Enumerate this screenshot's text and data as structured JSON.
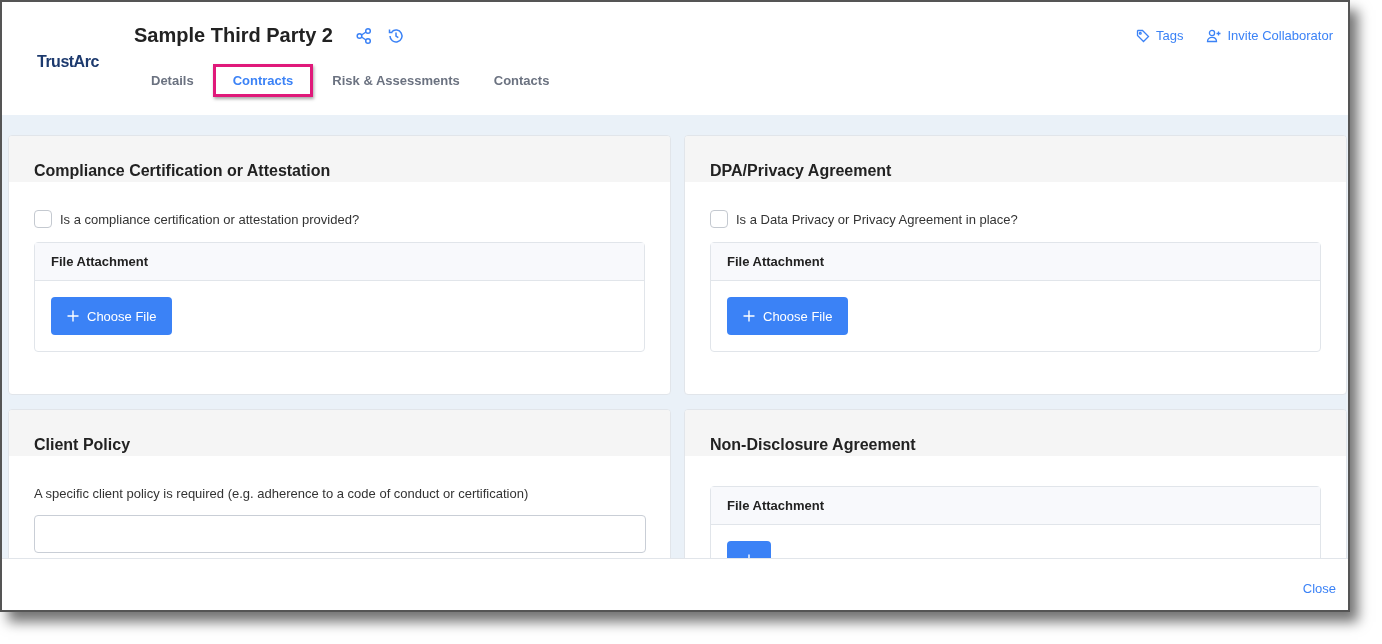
{
  "header": {
    "logo": "TrustArc",
    "title": "Sample Third Party 2",
    "actions": [
      {
        "kind": "tags",
        "label": "Tags"
      },
      {
        "kind": "invite",
        "label": "Invite Collaborator"
      }
    ]
  },
  "tabs": [
    {
      "label": "Details",
      "selected": false
    },
    {
      "label": "Contracts",
      "selected": true
    },
    {
      "label": "Risk & Assessments",
      "selected": false
    },
    {
      "label": "Contacts",
      "selected": false
    }
  ],
  "cards": [
    {
      "title": "Compliance Certification or Attestation",
      "checkbox": {
        "label": "Is a compliance certification or attestation provided?",
        "checked": false
      },
      "attachment": {
        "header": "File Attachment",
        "button": "Choose File"
      }
    },
    {
      "title": "DPA/Privacy Agreement",
      "checkbox": {
        "label": "Is a Data Privacy or Privacy Agreement in place?",
        "checked": false
      },
      "attachment": {
        "header": "File Attachment",
        "button": "Choose File"
      }
    },
    {
      "title": "Client Policy",
      "description": "A specific client policy is required (e.g. adherence to a code of conduct or certification)",
      "field": {
        "kind": "text"
      }
    },
    {
      "title": "Non-Disclosure Agreement",
      "attachment": {
        "header": "File Attachment"
      }
    }
  ],
  "footer": {
    "close": "Close"
  }
}
